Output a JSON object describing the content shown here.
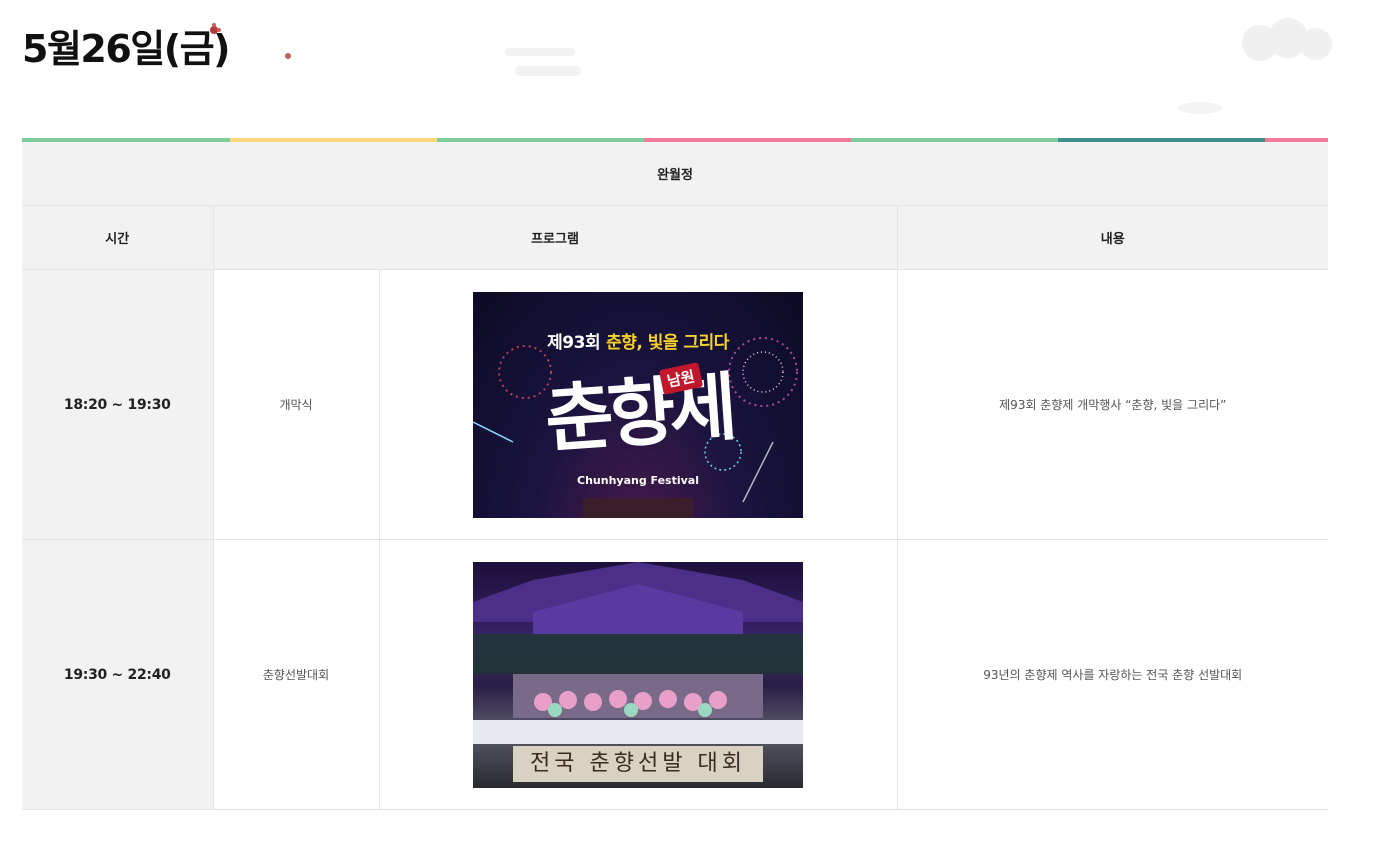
{
  "page": {
    "title": "5월26일(금)"
  },
  "colors": {
    "stripe": [
      "#7ecb9b",
      "#fbd77a",
      "#7ecb9b",
      "#f07a98",
      "#7ecb9b",
      "#3f8e8c",
      "#f07a98"
    ],
    "header_bg": "#f2f2f2",
    "border": "#e4e4e4"
  },
  "table": {
    "venue": "완월정",
    "headers": {
      "time": "시간",
      "program": "프로그램",
      "desc": "내용"
    },
    "rows": [
      {
        "time": "18:20 ~ 19:30",
        "name": "개막식",
        "image": {
          "kind": "festival-poster",
          "line1": "제93회",
          "line1_hl": "춘향, 빛을 그리다",
          "main": "춘향제",
          "badge": "남원",
          "sub": "Chunhyang Festival"
        },
        "desc": "제93회 춘향제 개막행사 “춘향, 빛을 그리다”"
      },
      {
        "time": "19:30 ~ 22:40",
        "name": "춘향선발대회",
        "image": {
          "kind": "stage-photo",
          "banner": "전국 춘향선발 대회"
        },
        "desc": "93년의 춘향제 역사를 자랑하는 전국 춘향 선발대회"
      }
    ]
  }
}
